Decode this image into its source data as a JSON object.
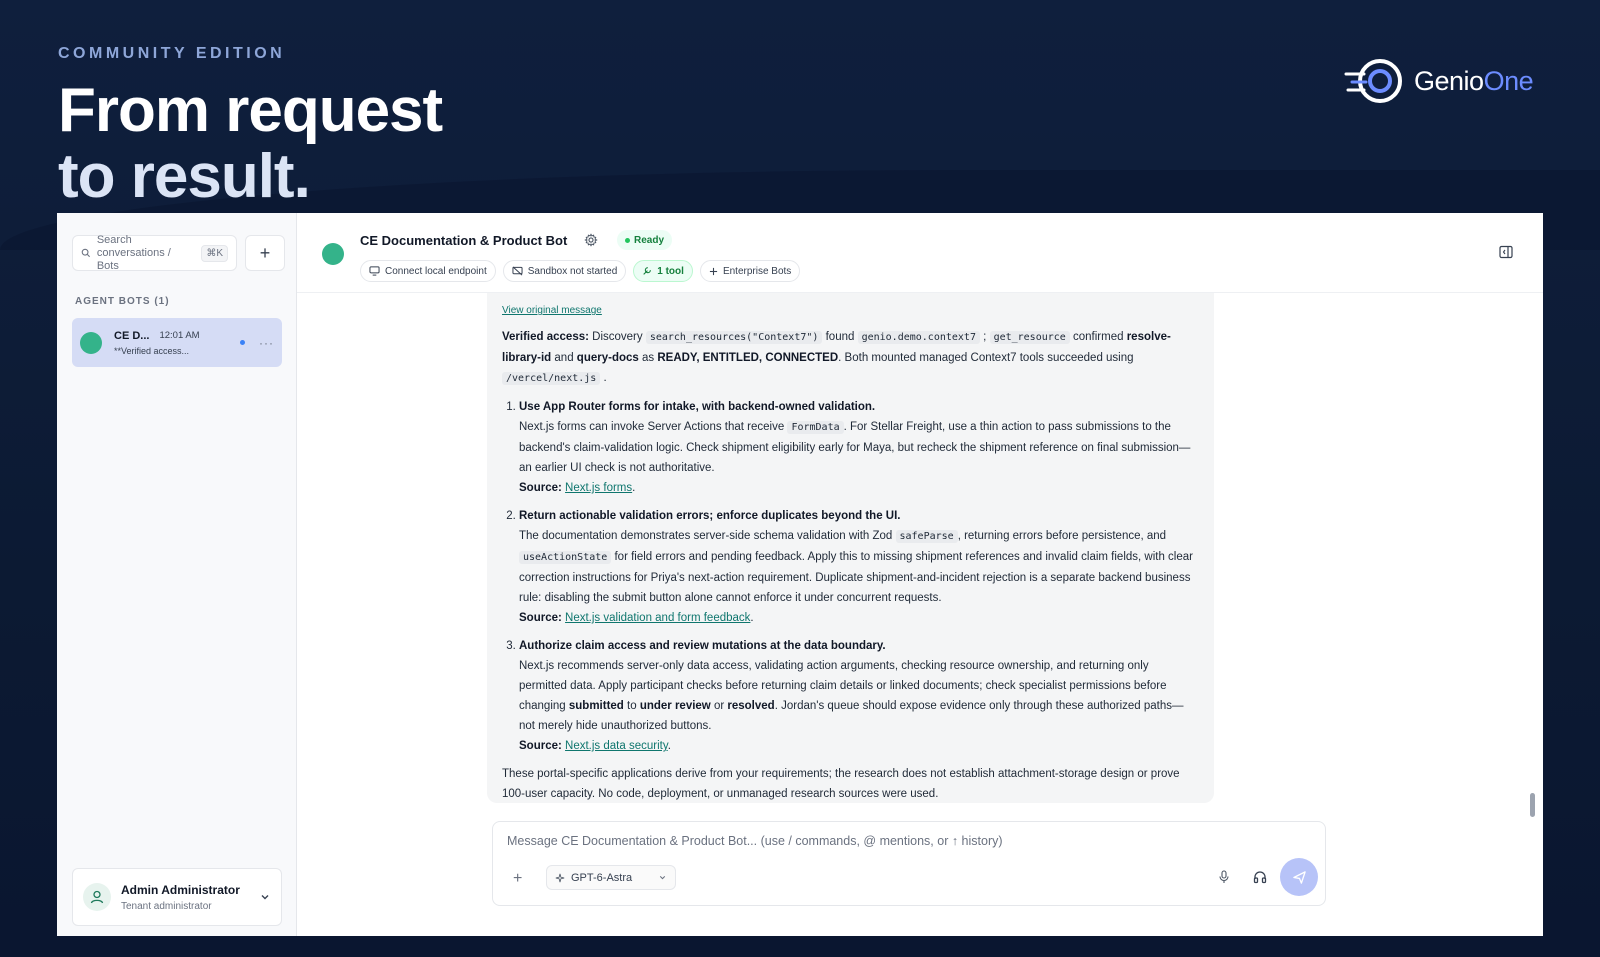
{
  "hero": {
    "edition": "COMMUNITY EDITION",
    "headline_line1": "From request",
    "headline_line2": "to result.",
    "logo_word1": "Genio",
    "logo_word2": "One"
  },
  "sidebar": {
    "search_placeholder": "Search conversations / Bots",
    "search_shortcut": "⌘K",
    "new_button": "+",
    "section_label": "AGENT BOTS (1)",
    "conversation": {
      "name": "CE D...",
      "time": "12:01 AM",
      "preview": "**Verified access...",
      "more": "···"
    },
    "user": {
      "name": "Admin Administrator",
      "role": "Tenant administrator"
    }
  },
  "header": {
    "title": "CE Documentation & Product Bot",
    "status": "Ready",
    "chips": {
      "connect": "Connect local endpoint",
      "sandbox": "Sandbox not started",
      "tools": "1 tool",
      "enterprise": "Enterprise Bots"
    }
  },
  "message": {
    "view_original": "View original message",
    "intro": {
      "label": "Verified access:",
      "t1": " Discovery ",
      "code1": "search_resources(\"Context7\")",
      "t2": " found ",
      "code2": "genio.demo.context7",
      "t3": " ; ",
      "code3": "get_resource",
      "t4": " confirmed ",
      "b1": "resolve-library-id",
      "t5": " and ",
      "b2": "query-docs",
      "t6": " as ",
      "b3": "READY, ENTITLED, CONNECTED",
      "t7": ". Both mounted managed Context7 tools succeeded using ",
      "code4": "/vercel/next.js",
      "t8": " ."
    },
    "item1": {
      "title": "Use App Router forms for intake, with backend-owned validation.",
      "t1": "Next.js forms can invoke Server Actions that receive ",
      "code1": "FormData",
      "t2": ". For Stellar Freight, use a thin action to pass submissions to the backend's claim-validation logic. Check shipment eligibility early for Maya, but recheck the shipment reference on final submission—an earlier UI check is not authoritative.",
      "source_label": "Source:",
      "source_link": "Next.js forms"
    },
    "item2": {
      "title": "Return actionable validation errors; enforce duplicates beyond the UI.",
      "t1": "The documentation demonstrates server-side schema validation with Zod ",
      "code1": "safeParse",
      "t2": ", returning errors before persistence, and ",
      "code2": "useActionState",
      "t3": " for field errors and pending feedback. Apply this to missing shipment references and invalid claim fields, with clear correction instructions for Priya's next-action requirement. Duplicate shipment-and-incident rejection is a separate backend business rule: disabling the submit button alone cannot enforce it under concurrent requests.",
      "source_label": "Source:",
      "source_link": "Next.js validation and form feedback"
    },
    "item3": {
      "title": "Authorize claim access and review mutations at the data boundary.",
      "t1": "Next.js recommends server-only data access, validating action arguments, checking resource ownership, and returning only permitted data. Apply participant checks before returning claim details or linked documents; check specialist permissions before changing ",
      "b1": "submitted",
      "t2": " to ",
      "b2": "under review",
      "t3": " or ",
      "b3": "resolved",
      "t4": ". Jordan's queue should expose evidence only through these authorized paths—not merely hide unauthorized buttons.",
      "source_label": "Source:",
      "source_link": "Next.js data security"
    },
    "closing": "These portal-specific applications derive from your requirements; the research does not establish attachment-storage design or prove 100-user capacity. No code, deployment, or unmanaged research sources were used."
  },
  "composer": {
    "placeholder": "Message CE Documentation & Product Bot... (use / commands, @ mentions, or ↑ history)",
    "add": "+",
    "model": "GPT-6-Astra"
  },
  "colors": {
    "brand_blue": "#6c8cff",
    "bot_green": "#34b38a",
    "selected_item": "#d5dcf5",
    "send_button": "#b7c3f8"
  }
}
